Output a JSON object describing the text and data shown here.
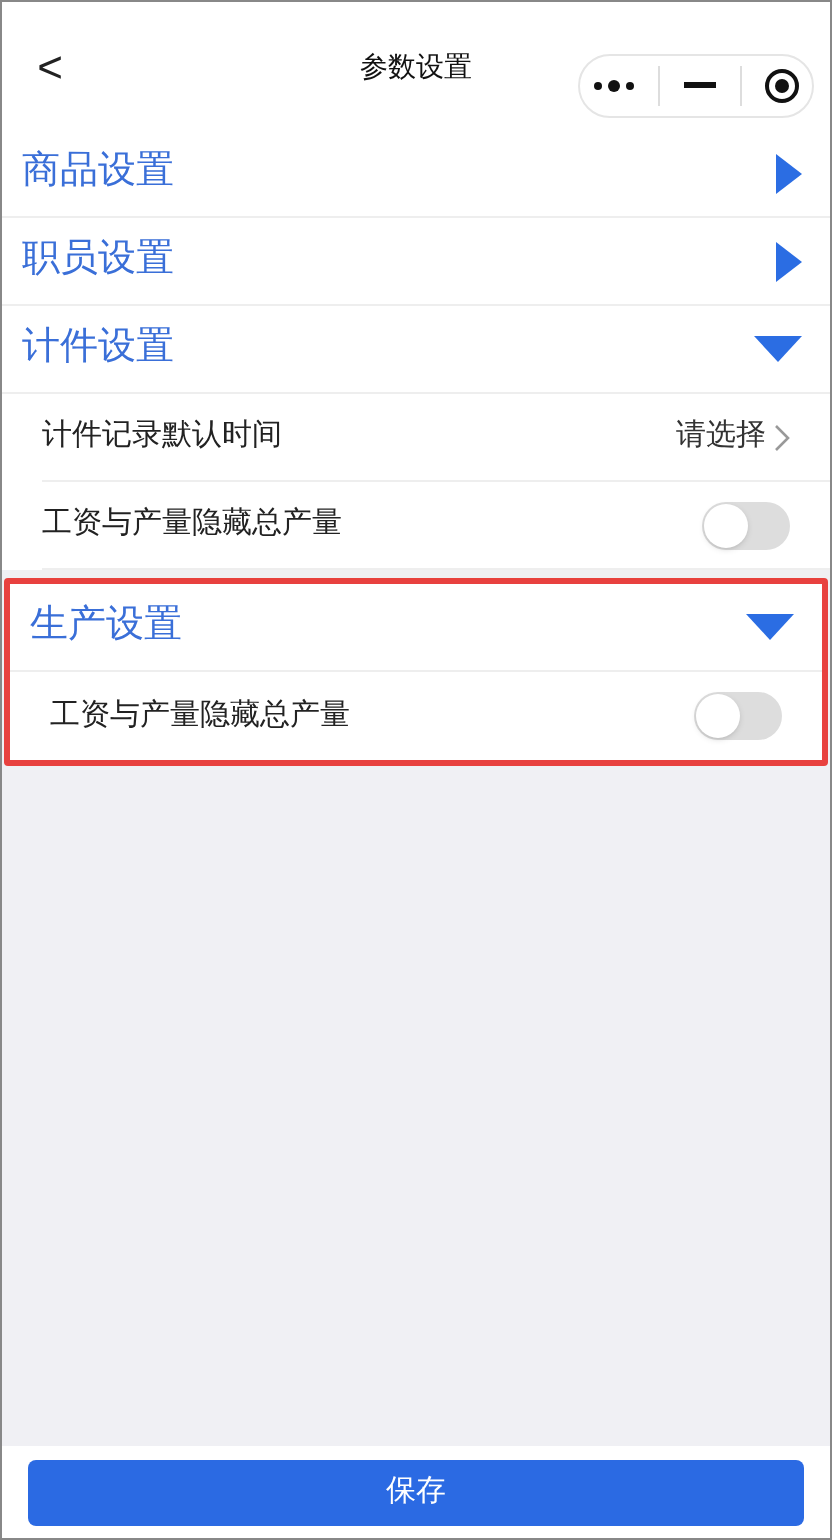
{
  "header": {
    "back": "<",
    "title": "参数设置"
  },
  "sections": [
    {
      "title": "商品设置",
      "expanded": false,
      "highlighted": false
    },
    {
      "title": "职员设置",
      "expanded": false,
      "highlighted": false
    },
    {
      "title": "计件设置",
      "expanded": true,
      "highlighted": false,
      "items": [
        {
          "kind": "select",
          "label": "计件记录默认时间",
          "value": "请选择"
        },
        {
          "kind": "toggle",
          "label": "工资与产量隐藏总产量",
          "on": false
        }
      ]
    },
    {
      "title": "生产设置",
      "expanded": true,
      "highlighted": true,
      "items": [
        {
          "kind": "toggle",
          "label": "工资与产量隐藏总产量",
          "on": false
        }
      ]
    }
  ],
  "save_button": "保存"
}
